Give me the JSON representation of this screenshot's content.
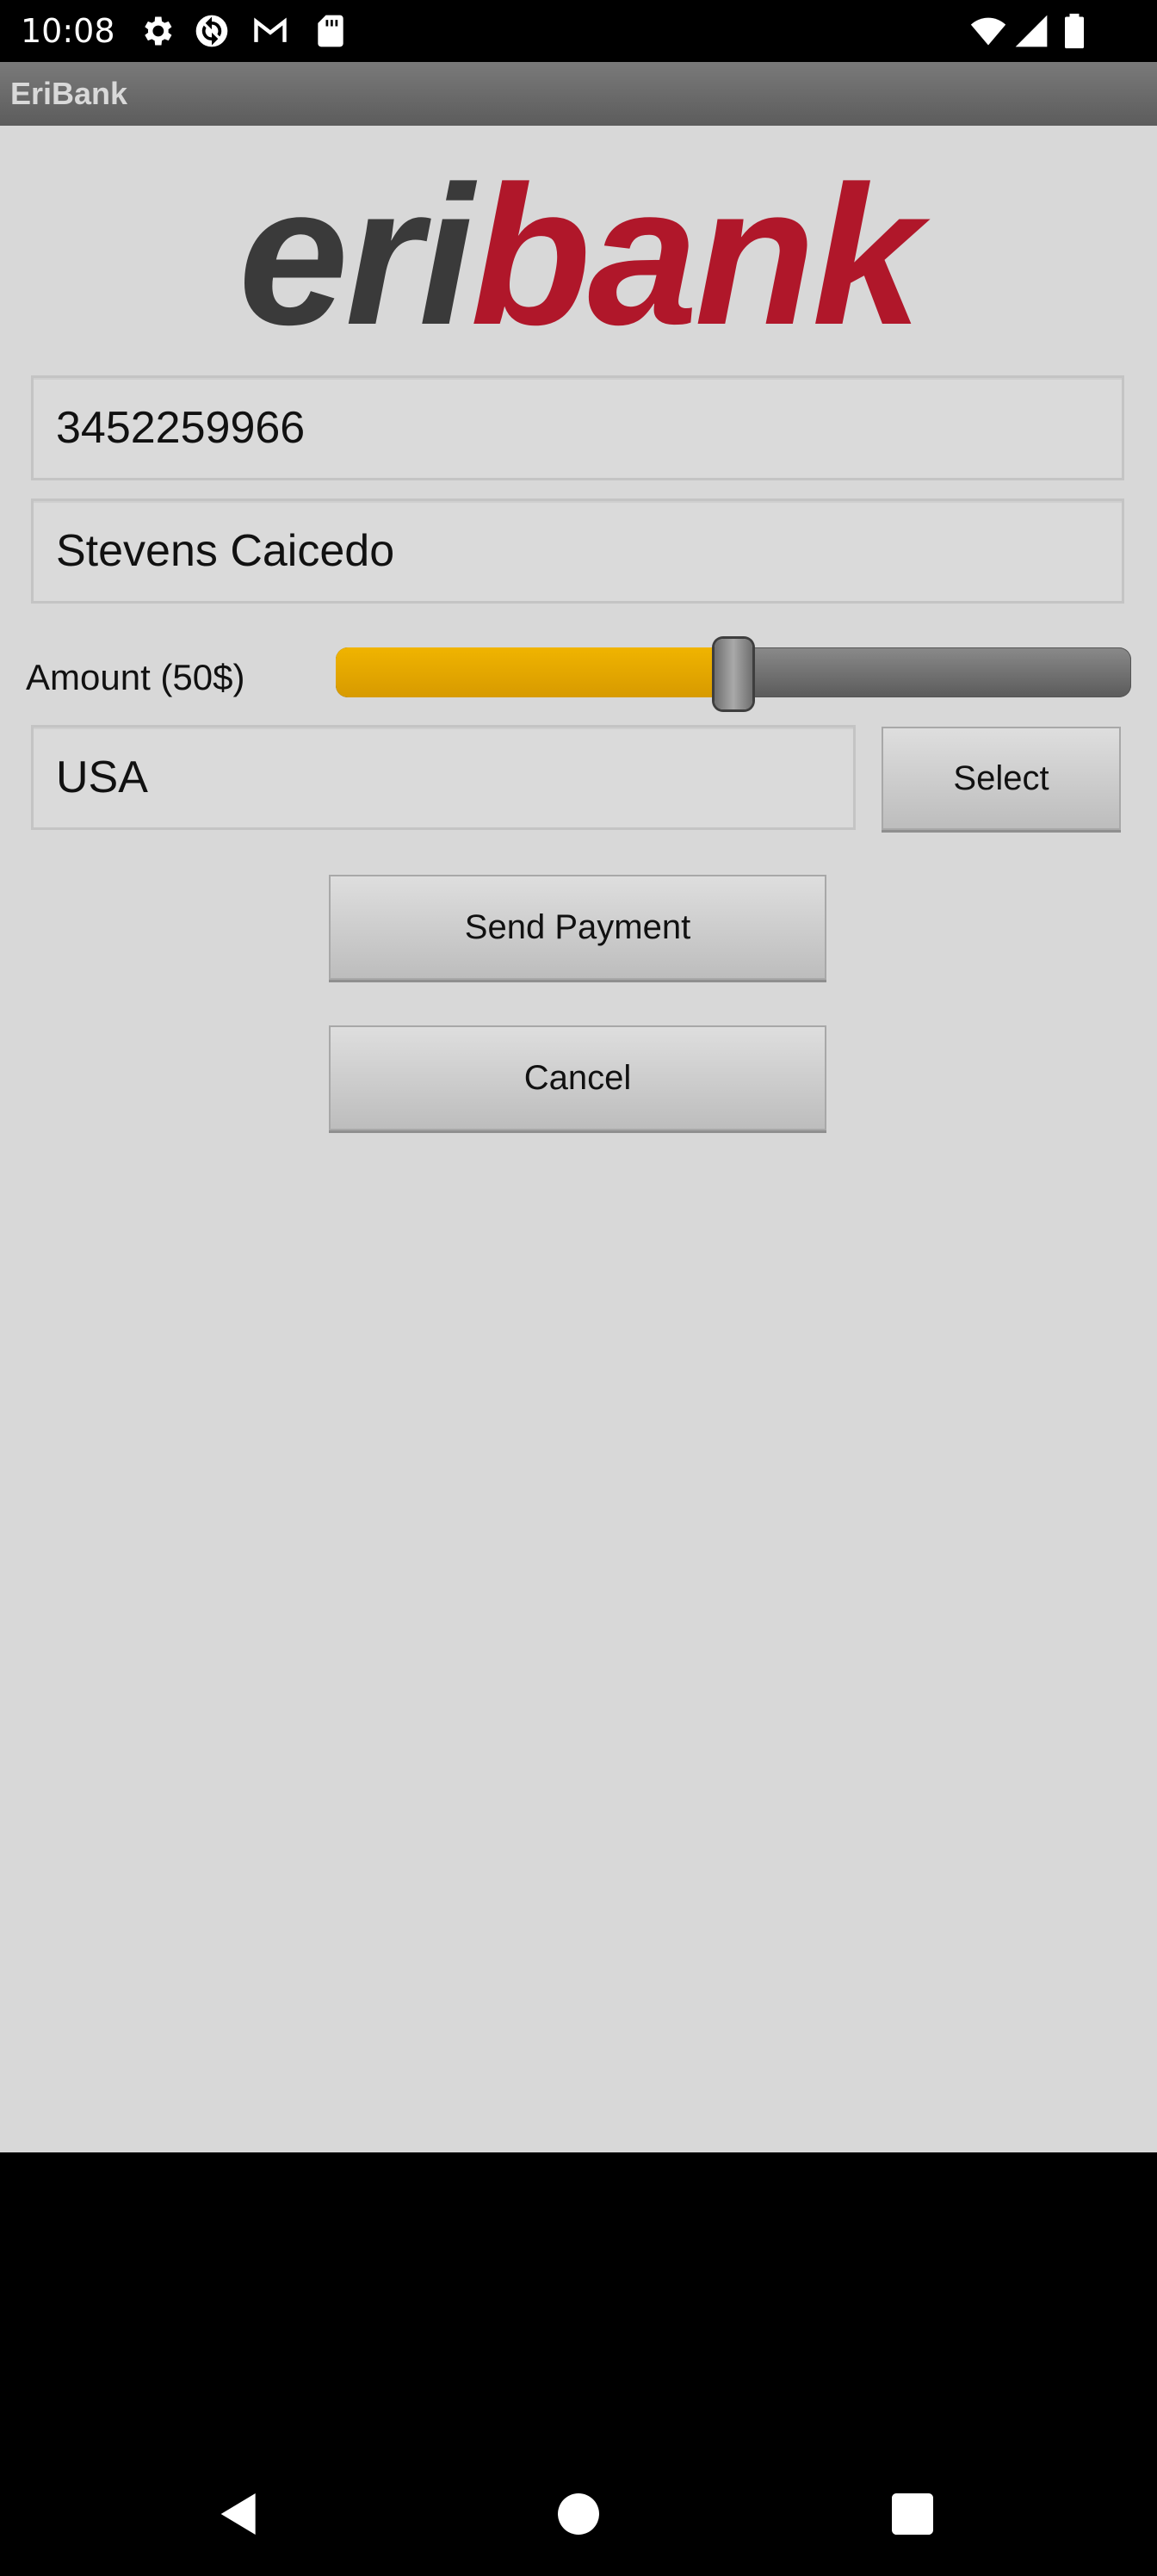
{
  "status_bar": {
    "time": "10:08",
    "icons": [
      "settings-icon",
      "sync-icon",
      "gmail-icon",
      "sd-card-icon",
      "wifi-icon",
      "cellular-signal-icon",
      "battery-icon"
    ]
  },
  "app": {
    "title": "EriBank"
  },
  "logo": {
    "part1": "eri",
    "part2": "bank",
    "color_dark": "#3a3a3a",
    "color_red": "#b0172a"
  },
  "form": {
    "phone_value": "3452259966",
    "name_value": "Stevens Caicedo",
    "amount_label": "Amount (50$)",
    "amount_slider_fraction": 0.5,
    "country_value": "USA",
    "select_label": "Select",
    "send_payment_label": "Send Payment",
    "cancel_label": "Cancel"
  },
  "colors": {
    "accent_slider": "#e5a800",
    "background": "#d8d8d8"
  },
  "nav": {
    "icons": [
      "back-icon",
      "home-icon",
      "recents-icon"
    ]
  }
}
